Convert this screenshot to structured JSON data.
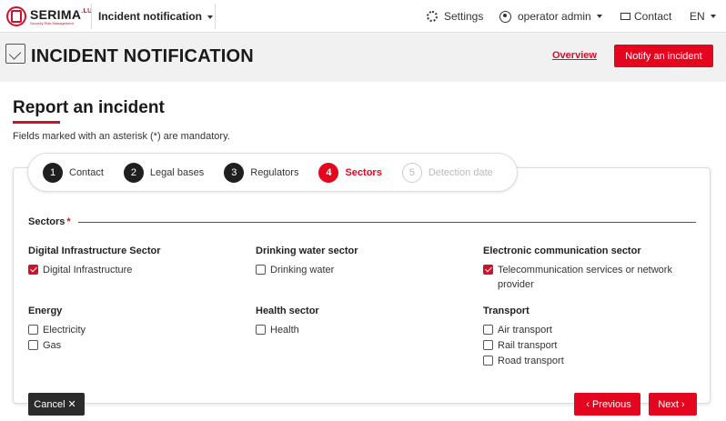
{
  "navbar": {
    "logo_text": "SERIMA",
    "logo_suffix": ".LU",
    "logo_tagline": "Security Risk Management",
    "app_menu": "Incident notification",
    "settings": "Settings",
    "user": "operator admin",
    "contact": "Contact",
    "language": "EN"
  },
  "header": {
    "title": "INCIDENT NOTIFICATION",
    "overview_link": "Overview",
    "notify_button": "Notify an incident"
  },
  "page": {
    "title": "Report an incident",
    "mandatory_note": "Fields marked with an asterisk (*) are mandatory."
  },
  "stepper": [
    {
      "num": "1",
      "label": "Contact",
      "state": "done"
    },
    {
      "num": "2",
      "label": "Legal bases",
      "state": "done"
    },
    {
      "num": "3",
      "label": "Regulators",
      "state": "done"
    },
    {
      "num": "4",
      "label": "Sectors",
      "state": "active"
    },
    {
      "num": "5",
      "label": "Detection date",
      "state": "disabled"
    }
  ],
  "sectors": {
    "legend": "Sectors",
    "required_mark": "*",
    "groups": [
      {
        "title": "Digital Infrastructure Sector",
        "options": [
          {
            "label": "Digital Infrastructure",
            "checked": true
          }
        ]
      },
      {
        "title": "Drinking water sector",
        "options": [
          {
            "label": "Drinking water",
            "checked": false
          }
        ]
      },
      {
        "title": "Electronic communication sector",
        "options": [
          {
            "label": "Telecommunication services or network provider",
            "checked": true
          }
        ]
      },
      {
        "title": "Energy",
        "options": [
          {
            "label": "Electricity",
            "checked": false
          },
          {
            "label": "Gas",
            "checked": false
          }
        ]
      },
      {
        "title": "Health sector",
        "options": [
          {
            "label": "Health",
            "checked": false
          }
        ]
      },
      {
        "title": "Transport",
        "options": [
          {
            "label": "Air transport",
            "checked": false
          },
          {
            "label": "Rail transport",
            "checked": false
          },
          {
            "label": "Road transport",
            "checked": false
          }
        ]
      }
    ]
  },
  "actions": {
    "cancel": "Cancel",
    "previous": "Previous",
    "next": "Next"
  },
  "colors": {
    "accent": "#e4051e",
    "dark": "#2b2b2b"
  }
}
